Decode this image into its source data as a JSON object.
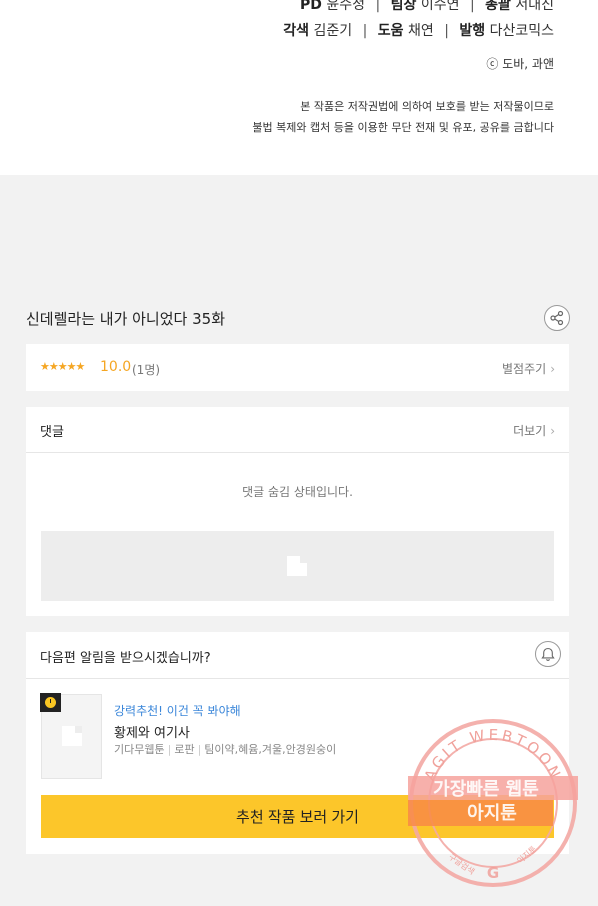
{
  "credits": {
    "line1": [
      {
        "role": "PD",
        "name": "윤수정"
      },
      {
        "role": "팀장",
        "name": "이수연"
      },
      {
        "role": "총괄",
        "name": "서대진"
      }
    ],
    "line2": [
      {
        "role": "각색",
        "name": "김준기"
      },
      {
        "role": "도움",
        "name": "채연"
      },
      {
        "role": "발행",
        "name": "다산코믹스"
      }
    ],
    "copyright": "ⓒ 도바, 과앤",
    "notice1": "본 작품은 저작권법에 의하여 보호를 받는 저작물이므로",
    "notice2": "불법 복제와 캡처 등을 이용한 무단 전재 및 유포, 공유를 금합니다"
  },
  "episode": {
    "title": "신데렐라는 내가 아니었다 35화",
    "share_icon": "share-icon"
  },
  "rating": {
    "stars": "★★★★★",
    "score": "10.0",
    "count": "(1명)",
    "rate_label": "별점주기"
  },
  "comments": {
    "label": "댓글",
    "more_label": "더보기",
    "hidden_message": "댓글 숨김 상태입니다."
  },
  "notify": {
    "question": "다음편 알림을 받으시겠습니까?",
    "bell_icon": "bell-icon"
  },
  "recommend": {
    "tag": "강력추천! 이건 꼭 봐야해",
    "title": "황제와 여기사",
    "meta_type": "기다무웹툰",
    "meta_genre": "로판",
    "meta_authors": "팀이약,혜윰,겨울,안경원숭이",
    "cta_label": "추천 작품 보러 가기"
  },
  "watermark": {
    "arc_text": "AGIT WEBTOON",
    "line1": "가장빠른 웹툰",
    "line2": "아지툰",
    "bottom_left": "구글검색",
    "bottom_right": "아지툰"
  },
  "colors": {
    "accent_star": "#f5a623",
    "cta_bg": "#fcc62a",
    "tag_blue": "#3a86d9",
    "watermark_red": "#e8433a"
  }
}
